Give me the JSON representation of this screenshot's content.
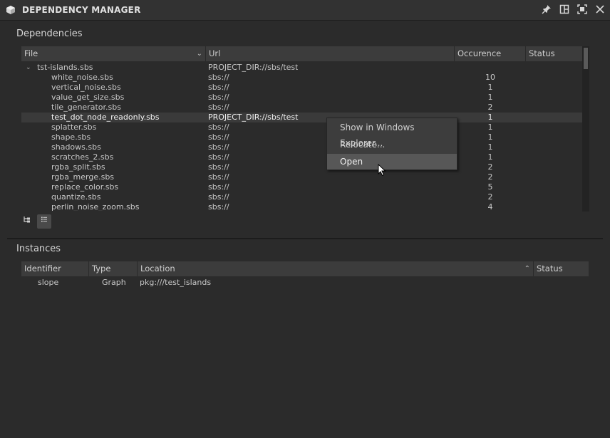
{
  "window": {
    "title": "DEPENDENCY MANAGER"
  },
  "icons": {
    "app": "cube-icon",
    "pin": "pin-icon",
    "layout": "layout-icon",
    "maximize": "maximize-icon",
    "close": "close-icon"
  },
  "dependencies": {
    "title": "Dependencies",
    "columns": [
      "File",
      "Url",
      "Occurence",
      "Status"
    ],
    "root": {
      "file": "tst-islands.sbs",
      "url": "PROJECT_DIR://sbs/test"
    },
    "rows": [
      {
        "file": "white_noise.sbs",
        "url": "sbs://",
        "occurence": "10",
        "status": ""
      },
      {
        "file": "vertical_noise.sbs",
        "url": "sbs://",
        "occurence": "1",
        "status": ""
      },
      {
        "file": "value_get_size.sbs",
        "url": "sbs://",
        "occurence": "1",
        "status": ""
      },
      {
        "file": "tile_generator.sbs",
        "url": "sbs://",
        "occurence": "2",
        "status": ""
      },
      {
        "file": "test_dot_node_readonly.sbs",
        "url": "PROJECT_DIR://sbs/test",
        "occurence": "1",
        "status": ""
      },
      {
        "file": "splatter.sbs",
        "url": "sbs://",
        "occurence": "1",
        "status": ""
      },
      {
        "file": "shape.sbs",
        "url": "sbs://",
        "occurence": "1",
        "status": ""
      },
      {
        "file": "shadows.sbs",
        "url": "sbs://",
        "occurence": "1",
        "status": ""
      },
      {
        "file": "scratches_2.sbs",
        "url": "sbs://",
        "occurence": "1",
        "status": ""
      },
      {
        "file": "rgba_split.sbs",
        "url": "sbs://",
        "occurence": "2",
        "status": ""
      },
      {
        "file": "rgba_merge.sbs",
        "url": "sbs://",
        "occurence": "2",
        "status": ""
      },
      {
        "file": "replace_color.sbs",
        "url": "sbs://",
        "occurence": "5",
        "status": ""
      },
      {
        "file": "quantize.sbs",
        "url": "sbs://",
        "occurence": "2",
        "status": ""
      },
      {
        "file": "perlin_noise_zoom.sbs",
        "url": "sbs://",
        "occurence": "4",
        "status": ""
      }
    ],
    "selected_index": 4
  },
  "view_buttons": {
    "tree": "tree-view-icon",
    "list": "list-view-icon"
  },
  "context_menu": {
    "items": [
      "Show in Windows Explorer...",
      "Relocate...",
      "Open"
    ],
    "highlighted_index": 2
  },
  "instances": {
    "title": "Instances",
    "columns": [
      "Identifier",
      "Type",
      "Location",
      "Status"
    ],
    "rows": [
      {
        "identifier": "slope",
        "type": "Graph",
        "location": "pkg:///test_islands",
        "status": ""
      }
    ]
  },
  "colors": {
    "background": "#2b2b2b",
    "header": "#3c3c3c",
    "menu": "#3d3d3d",
    "menu_highlight": "#575757"
  }
}
